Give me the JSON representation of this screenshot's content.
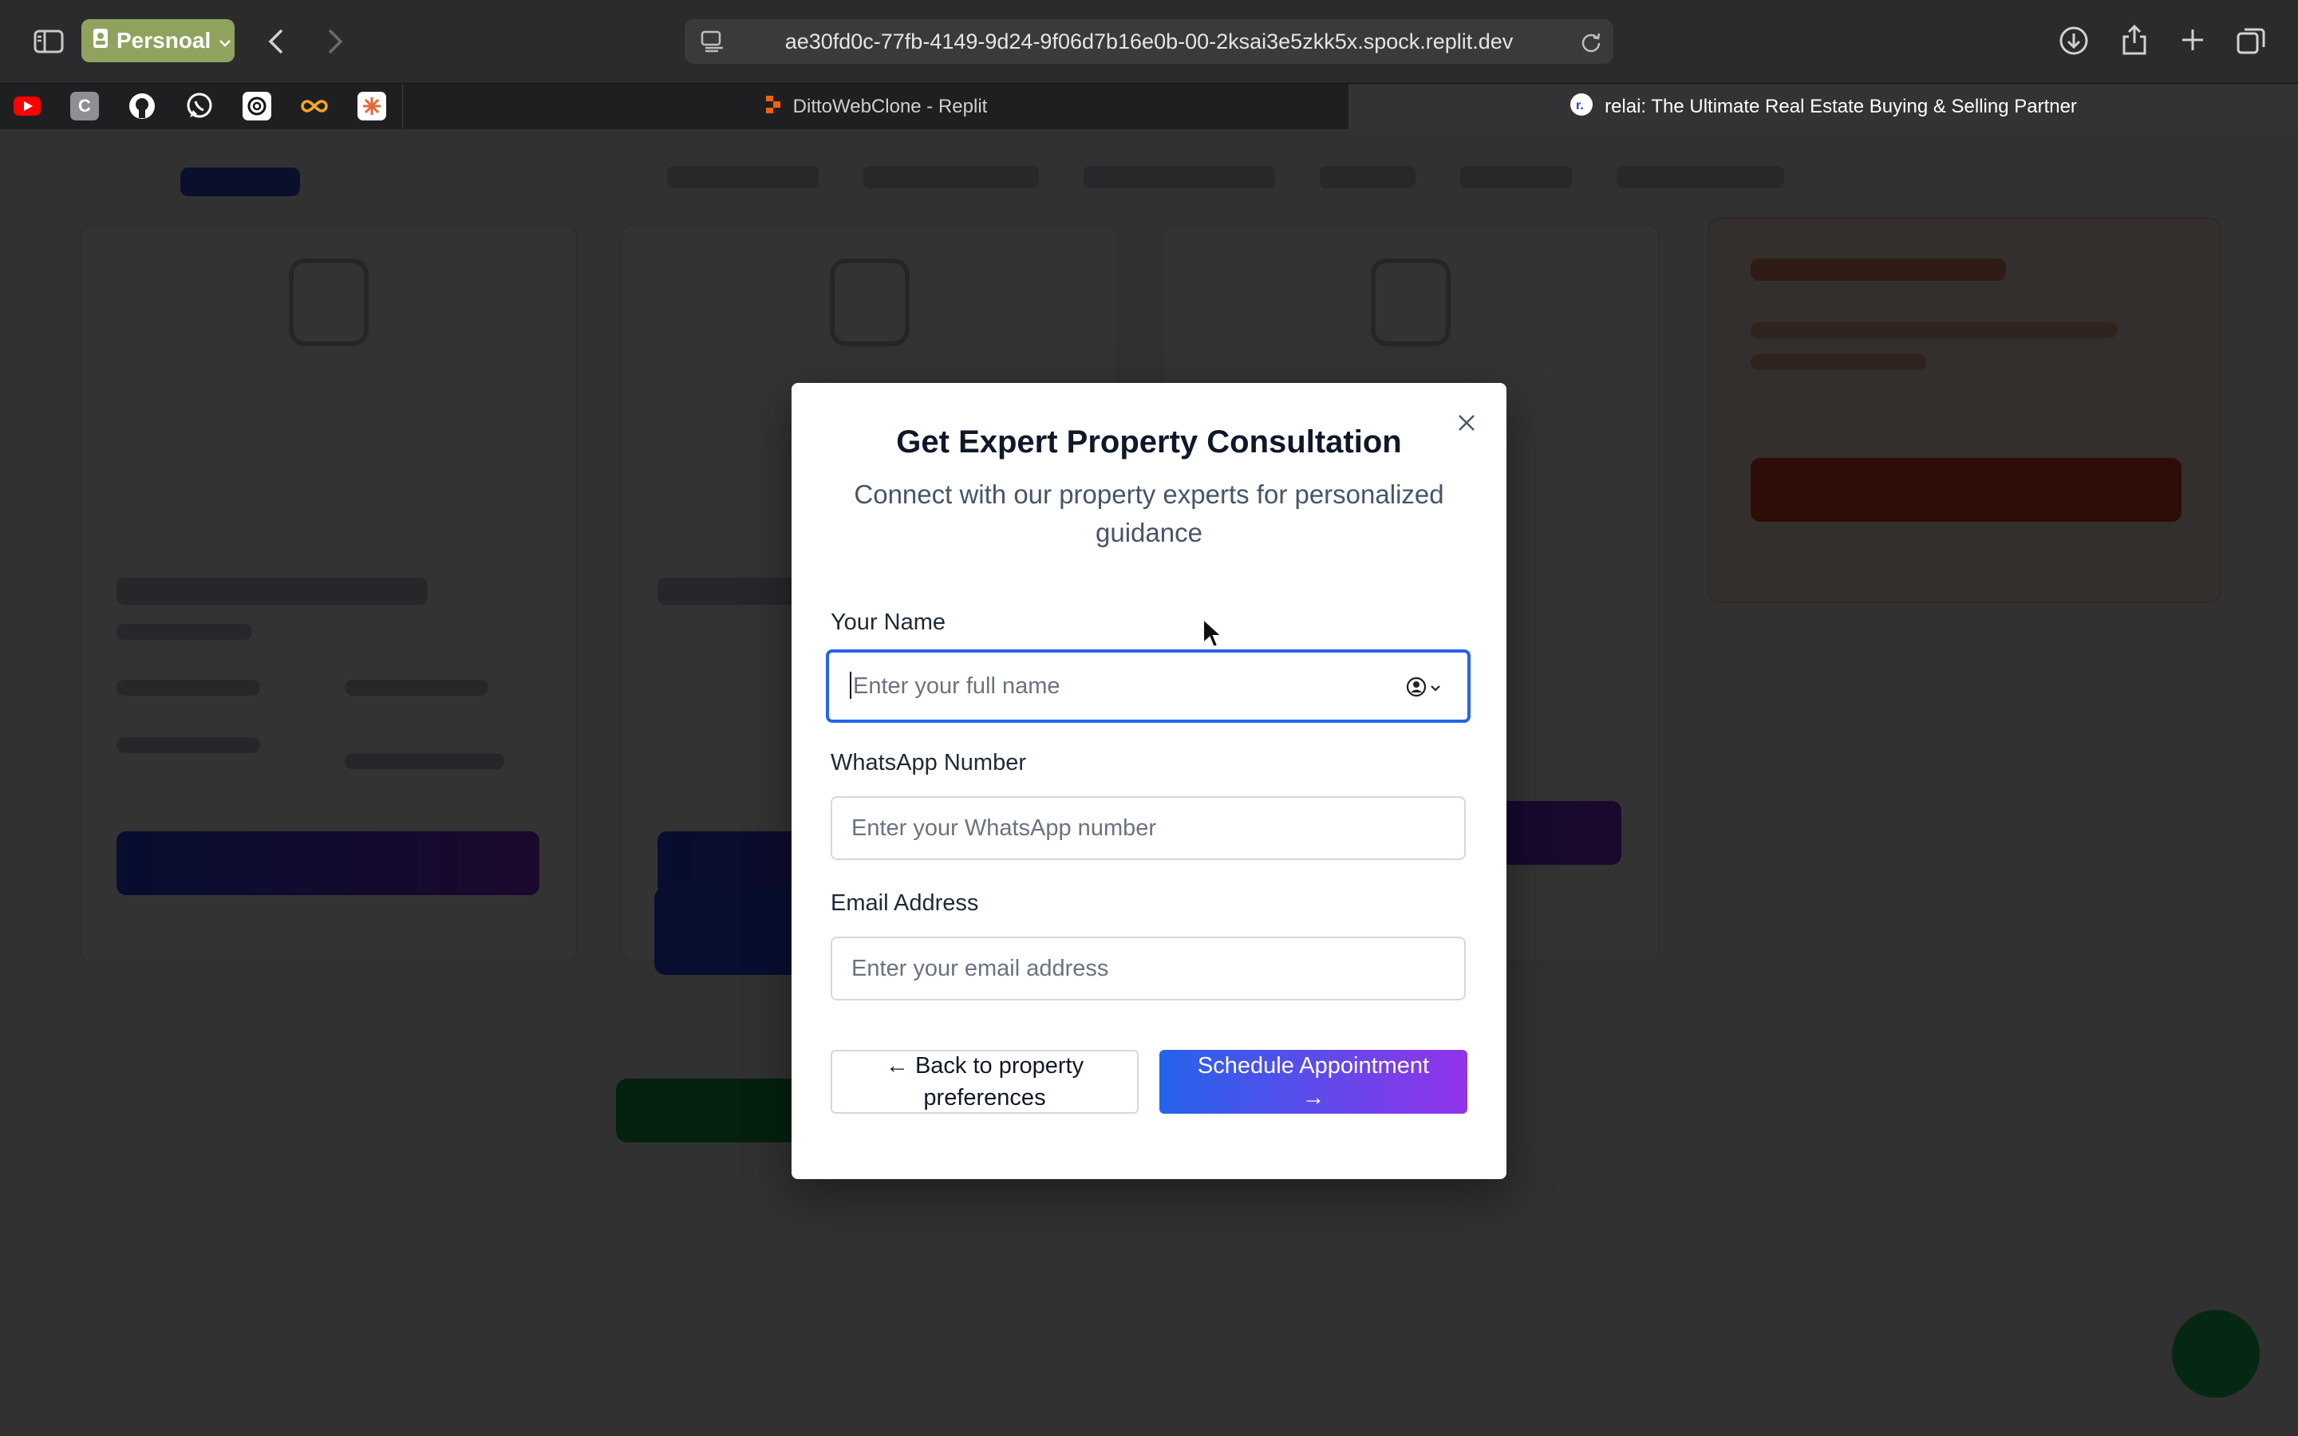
{
  "browser": {
    "profile_label": "Persnoal",
    "url": "ae30fd0c-77fb-4149-9d24-9f06d7b16e0b-00-2ksai3e5zkk5x.spock.replit.dev",
    "bookmark_letter": "C",
    "tabs": [
      {
        "title": "DittoWebClone - Replit",
        "active": false
      },
      {
        "title": "relai: The Ultimate Real Estate Buying & Selling Partner",
        "active": true
      }
    ]
  },
  "modal": {
    "title": "Get Expert Property Consultation",
    "subtitle": "Connect with our property experts for personalized guidance",
    "fields": {
      "name": {
        "label": "Your Name",
        "placeholder": "Enter your full name"
      },
      "whatsapp": {
        "label": "WhatsApp Number",
        "placeholder": "Enter your WhatsApp number"
      },
      "email": {
        "label": "Email Address",
        "placeholder": "Enter your email address"
      }
    },
    "back_button": "← Back to property preferences",
    "submit_button": "Schedule Appointment →"
  },
  "colors": {
    "primary_gradient_start": "#2563eb",
    "primary_gradient_end": "#9333ea",
    "focus_ring": "#2563eb",
    "profile_badge": "#8fa35e"
  }
}
